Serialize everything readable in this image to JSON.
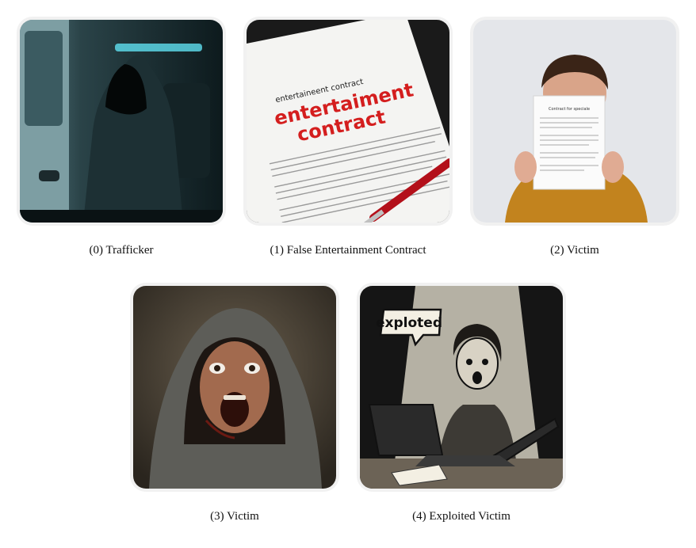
{
  "panels": [
    {
      "caption": "(0) Trafficker",
      "icon": "hooded-figure-icon"
    },
    {
      "caption": "(1) False Entertainment Contract",
      "icon": "contract-document-icon",
      "doc_small_title": "entertaineent contract",
      "doc_big_line1": "entertaiment",
      "doc_big_line2": "contract"
    },
    {
      "caption": "(2) Victim",
      "icon": "person-holding-paper-icon",
      "paper_title": "Contract for speciale"
    },
    {
      "caption": "(3) Victim",
      "icon": "screaming-hooded-woman-icon"
    },
    {
      "caption": "(4) Exploited Victim",
      "icon": "woman-at-laptop-icon",
      "sign_text": "exploted"
    }
  ]
}
